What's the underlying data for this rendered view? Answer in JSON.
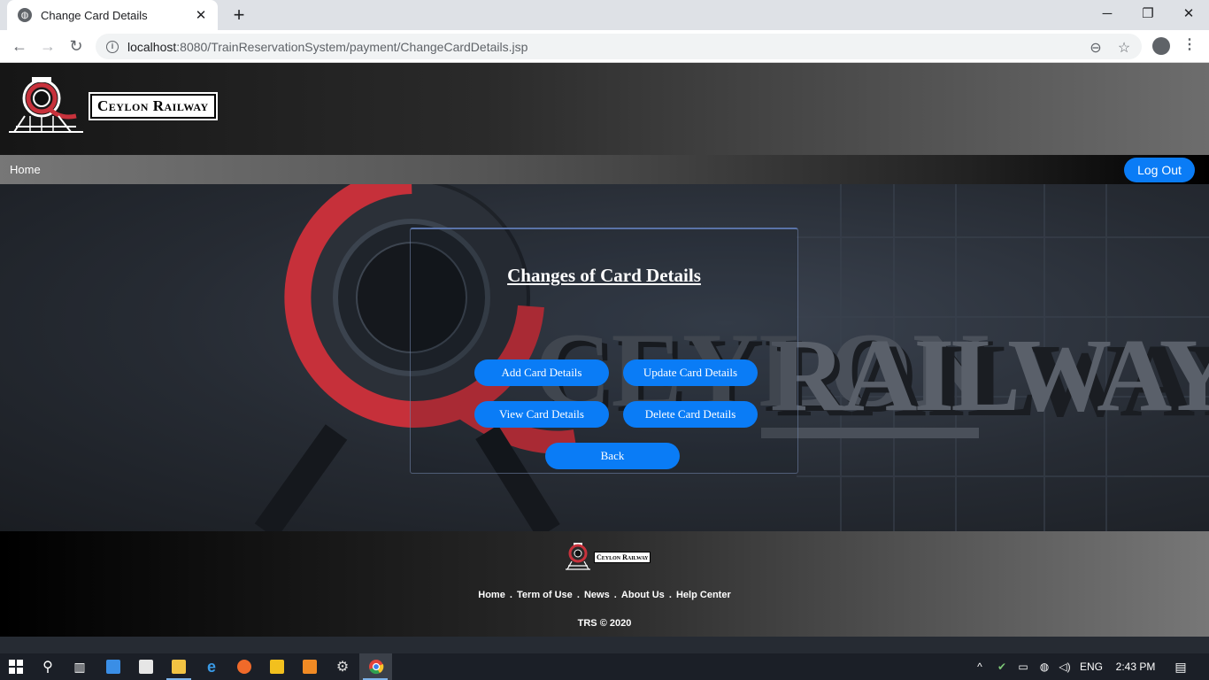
{
  "browser": {
    "tab_title": "Change Card Details",
    "new_tab_symbol": "+",
    "close_tab_symbol": "✕",
    "url_host": "localhost",
    "url_rest": ":8080/TrainReservationSystem/payment/ChangeCardDetails.jsp",
    "icons": [
      "back-arrow-icon",
      "forward-arrow-icon",
      "reload-icon",
      "info-icon",
      "zoom-out-icon",
      "star-icon",
      "profile-icon",
      "menu-icon"
    ]
  },
  "site": {
    "logo_text": "Ceylon Railway",
    "nav_home": "Home",
    "logout_label": "Log Out",
    "panel_title": "Changes of Card Details",
    "buttons": {
      "add": "Add Card Details",
      "update": "Update Card Details",
      "view": "View Card Details",
      "delete": "Delete Card Details",
      "back": "Back"
    },
    "footer": {
      "logo_text": "Ceylon Railway",
      "links": [
        "Home",
        "Term of Use",
        "News",
        "About Us",
        "Help Center"
      ],
      "separator": ".",
      "copyright": "TRS © 2020"
    },
    "colors": {
      "accent": "#0a7cf6",
      "logo_red": "#c8323c"
    }
  },
  "taskbar": {
    "language": "ENG",
    "time": "2:43 PM"
  }
}
